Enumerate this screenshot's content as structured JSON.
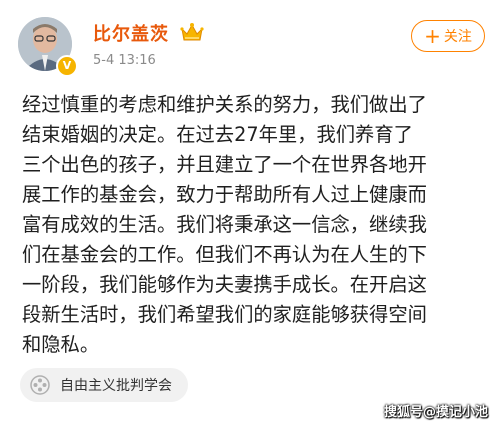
{
  "post": {
    "author": "比尔盖茨",
    "timestamp": "5-4 13:16",
    "follow_label": "关注",
    "text": "经过慎重的考虑和维护关系的努力，我们做出了\n结束婚姻的决定。在过去27年里，我们养育了\n三个出色的孩子，并且建立了一个在世界各地开\n展工作的基金会，致力于帮助所有人过上健康而\n富有成效的生活。我们将秉承这一信念，继续我\n们在基金会的工作。但我们不再认为在人生的下\n一阶段，我们能够作为夫妻携手成长。在开启这\n段新生活时，我们希望我们的家庭能够获得空间\n和隐私。",
    "topic": "自由主义批判学会"
  },
  "watermark": "搜狐号@摸记小池",
  "colors": {
    "accent": "#ff8200",
    "username": "#e8590c",
    "verified_badge": "#f6b400"
  },
  "icons": [
    "crown-icon",
    "verified-badge-icon",
    "plus-icon",
    "topic-icon"
  ]
}
